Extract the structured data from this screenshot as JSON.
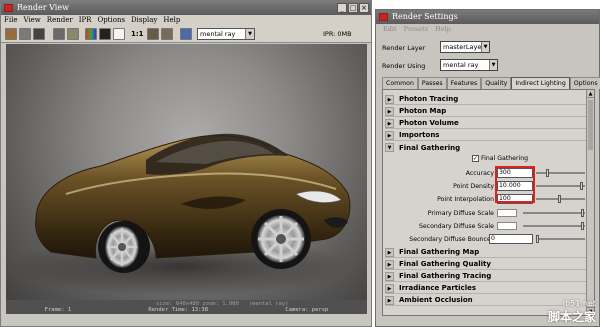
{
  "render_view": {
    "title": "Render View",
    "menu": [
      "File",
      "View",
      "Render",
      "IPR",
      "Options",
      "Display",
      "Help"
    ],
    "ratio_label": "1:1",
    "renderer": "mental ray",
    "ipr_status": "IPR: 0MB",
    "status_bar": {
      "size_info": "size: 640x480 zoom: 1.000",
      "renderer_tag": "(mental ray)",
      "frame": "Frame: 1",
      "render_time": "Render Time: 13:38",
      "camera": "Camera: persp"
    }
  },
  "render_settings": {
    "title": "Render Settings",
    "menu": [
      "Edit",
      "Presets",
      "Help"
    ],
    "render_layer_label": "Render Layer",
    "render_layer_value": "masterLayer",
    "render_using_label": "Render Using",
    "render_using_value": "mental ray",
    "tabs": [
      "Common",
      "Passes",
      "Features",
      "Quality",
      "Indirect Lighting",
      "Options"
    ],
    "active_tab": "Indirect Lighting",
    "sections_top": [
      "Photon Tracing",
      "Photon Map",
      "Photon Volume",
      "Importons"
    ],
    "final_gathering": {
      "header": "Final Gathering",
      "checkbox_label": "Final Gathering",
      "checked": true,
      "params": [
        {
          "label": "Accuracy",
          "value": "300"
        },
        {
          "label": "Point Density",
          "value": "10.000"
        },
        {
          "label": "Point Interpolation",
          "value": "100"
        }
      ],
      "color_params": [
        "Primary Diffuse Scale",
        "Secondary Diffuse Scale"
      ],
      "bounces_label": "Secondary Diffuse Bounces",
      "bounces_value": "0"
    },
    "sections_bottom": [
      "Final Gathering Map",
      "Final Gathering Quality",
      "Final Gathering Tracing",
      "Irradiance Particles",
      "Ambient Occlusion"
    ]
  },
  "watermark": {
    "site": "jb51.net",
    "cn": "脚本之家"
  },
  "colors": {
    "highlight": "#e0201c",
    "titlebar": "#6a6a6a",
    "car_body": "#5a4520"
  }
}
